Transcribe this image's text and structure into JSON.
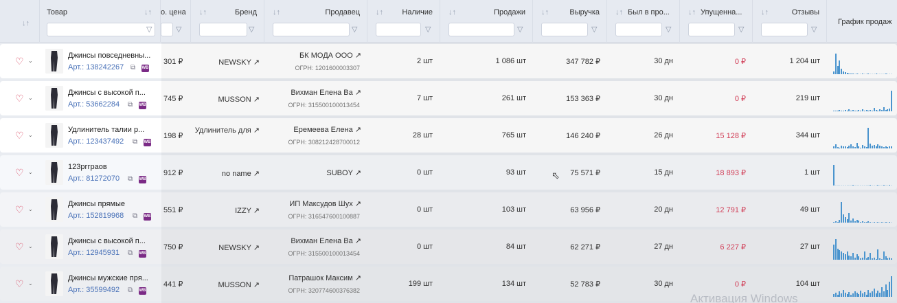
{
  "header": {
    "product": "Товар",
    "price": "о. цена",
    "brand": "Бренд",
    "seller": "Продавец",
    "stock": "Наличие",
    "sales": "Продажи",
    "revenue": "Выручка",
    "was_in": "Был в про...",
    "lost": "Упущенна...",
    "reviews": "Отзывы",
    "chart": "График продаж",
    "sort_icon": "↓↑",
    "filter_icon": "funnel-icon"
  },
  "rows": [
    {
      "name": "Джинсы повседневны...",
      "art": "Арт.: 138242267",
      "price": "301 ₽",
      "brand": "NEWSKY ↗",
      "seller": "БК МОДА ООО ↗",
      "ogrn": "ОГРН: 1201600003307",
      "stock": "2 шт",
      "sales": "1 086 шт",
      "revenue": "347 782 ₽",
      "days": "30 дн",
      "lost": "0 ₽",
      "reviews": "1 204 шт",
      "bars": [
        4,
        30,
        12,
        20,
        8,
        4,
        3,
        2,
        1,
        1,
        1,
        0,
        1,
        0,
        0,
        1,
        0,
        0,
        1,
        0,
        0,
        0,
        1,
        0,
        0,
        0,
        0,
        1,
        0,
        0,
        0
      ]
    },
    {
      "name": "Джинсы с высокой п...",
      "art": "Арт.: 53662284",
      "price": "745 ₽",
      "brand": "MUSSON ↗",
      "seller": "Вихман Елена Ва ↗",
      "ogrn": "ОГРН: 315500100013454",
      "stock": "7 шт",
      "sales": "261 шт",
      "revenue": "153 363 ₽",
      "days": "30 дн",
      "lost": "0 ₽",
      "reviews": "219 шт",
      "bars": [
        1,
        1,
        1,
        2,
        1,
        1,
        2,
        1,
        3,
        1,
        2,
        1,
        1,
        2,
        1,
        3,
        1,
        2,
        1,
        2,
        1,
        5,
        2,
        1,
        3,
        2,
        6,
        2,
        3,
        4,
        30
      ]
    },
    {
      "name": "Удлинитель талии р...",
      "art": "Арт.: 123437492",
      "price": "198 ₽",
      "brand": "Удлинитель для ↗",
      "seller": "Еремеева Елена ↗",
      "ogrn": "ОГРН: 308212428700012",
      "stock": "28 шт",
      "sales": "765 шт",
      "revenue": "146 240 ₽",
      "days": "26 дн",
      "lost": "15 128 ₽",
      "reviews": "344 шт",
      "bars": [
        3,
        6,
        2,
        1,
        4,
        3,
        3,
        2,
        4,
        6,
        3,
        2,
        8,
        3,
        1,
        5,
        3,
        2,
        30,
        7,
        4,
        5,
        3,
        6,
        4,
        3,
        2,
        3,
        2,
        3,
        3
      ]
    },
    {
      "name": "123ргграов",
      "art": "Арт.: 81272070",
      "price": "912 ₽",
      "brand": "no name ↗",
      "seller": "SUBOY ↗",
      "ogrn": "",
      "stock": "0 шт",
      "sales": "93 шт",
      "revenue": "75 571 ₽",
      "days": "15 дн",
      "lost": "18 893 ₽",
      "reviews": "1 шт",
      "bars": [
        28,
        0,
        0,
        0,
        0,
        0,
        0,
        0,
        0,
        0,
        1,
        0,
        0,
        0,
        0,
        0,
        0,
        0,
        0,
        1,
        0,
        0,
        0,
        1,
        0,
        0,
        1,
        0,
        0,
        1,
        0
      ]
    },
    {
      "name": "Джинсы прямые",
      "art": "Арт.: 152819968",
      "price": "551 ₽",
      "brand": "IZZY ↗",
      "seller": "ИП Максудов Шух ↗",
      "ogrn": "ОГРН: 316547600100887",
      "stock": "0 шт",
      "sales": "103 шт",
      "revenue": "63 956 ₽",
      "days": "20 дн",
      "lost": "12 791 ₽",
      "reviews": "49 шт",
      "bars": [
        1,
        2,
        1,
        4,
        30,
        12,
        8,
        5,
        14,
        3,
        6,
        2,
        4,
        3,
        1,
        2,
        1,
        1,
        2,
        1,
        0,
        1,
        0,
        1,
        0,
        1,
        0,
        1,
        0,
        1,
        0
      ]
    },
    {
      "name": "Джинсы с высокой п...",
      "art": "Арт.: 12945931",
      "price": "750 ₽",
      "brand": "NEWSKY ↗",
      "seller": "Вихман Елена Ва ↗",
      "ogrn": "ОГРН: 315500100013454",
      "stock": "0 шт",
      "sales": "84 шт",
      "revenue": "62 271 ₽",
      "days": "27 дн",
      "lost": "6 227 ₽",
      "reviews": "27 шт",
      "bars": [
        22,
        30,
        16,
        14,
        12,
        10,
        8,
        12,
        6,
        5,
        10,
        3,
        8,
        5,
        2,
        3,
        12,
        2,
        4,
        10,
        2,
        3,
        1,
        15,
        2,
        1,
        12,
        5,
        2,
        3,
        2
      ]
    },
    {
      "name": "Джинсы мужские пря...",
      "art": "Арт.: 35599492",
      "price": "441 ₽",
      "brand": "MUSSON ↗",
      "seller": "Патрашок Максим ↗",
      "ogrn": "ОГРН: 320774600376382",
      "stock": "199 шт",
      "sales": "134 шт",
      "revenue": "52 783 ₽",
      "days": "30 дн",
      "lost": "0 ₽",
      "reviews": "104 шт",
      "bars": [
        4,
        6,
        3,
        8,
        5,
        10,
        6,
        4,
        7,
        3,
        5,
        8,
        6,
        4,
        9,
        5,
        7,
        3,
        10,
        6,
        8,
        12,
        5,
        9,
        6,
        14,
        8,
        18,
        10,
        22,
        30
      ]
    }
  ],
  "watermark": "Активация Windows"
}
